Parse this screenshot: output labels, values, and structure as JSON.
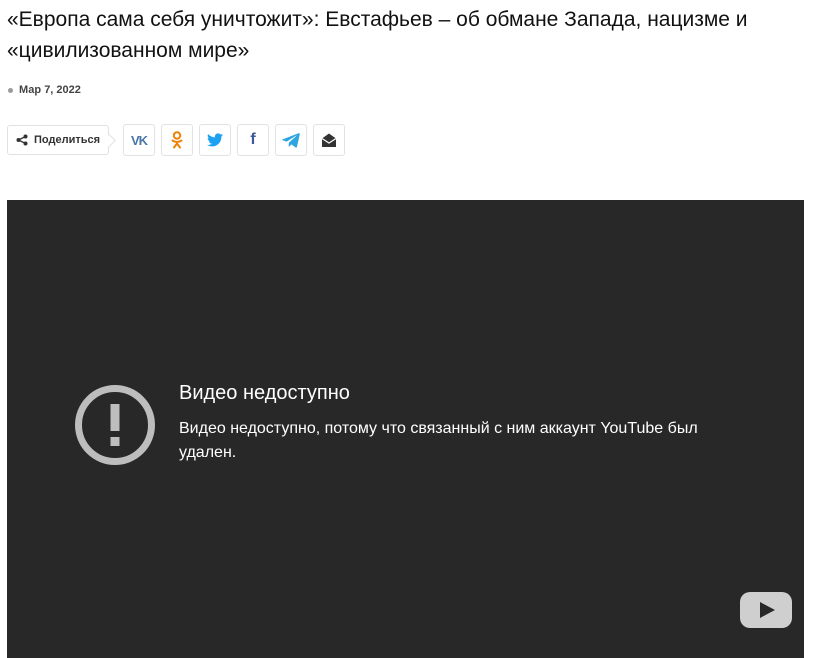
{
  "article": {
    "title": "«Европа сама себя уничтожит»: Евстафьев – об обмане Запада, нацизме и «цивилизованном мире»",
    "date": "Мар 7, 2022"
  },
  "share": {
    "label": "Поделиться",
    "buttons": [
      {
        "name": "vk",
        "icon": "vk-icon",
        "text": "VK",
        "color": "#4a76a8"
      },
      {
        "name": "odnoklassniki",
        "icon": "odnoklassniki-icon",
        "color": "#ee8208"
      },
      {
        "name": "twitter",
        "icon": "twitter-icon",
        "color": "#1da1f2"
      },
      {
        "name": "facebook",
        "icon": "facebook-icon",
        "text": "f",
        "color": "#3b5998"
      },
      {
        "name": "telegram",
        "icon": "telegram-icon",
        "color": "#2ca5e0"
      },
      {
        "name": "email",
        "icon": "email-icon",
        "color": "#333333"
      }
    ]
  },
  "video": {
    "title": "Видео недоступно",
    "message": "Видео недоступно, потому что связанный с ним аккаунт YouTube был удален.",
    "background": "#282828",
    "icon": "warning-icon",
    "logo": "youtube-logo-icon"
  }
}
